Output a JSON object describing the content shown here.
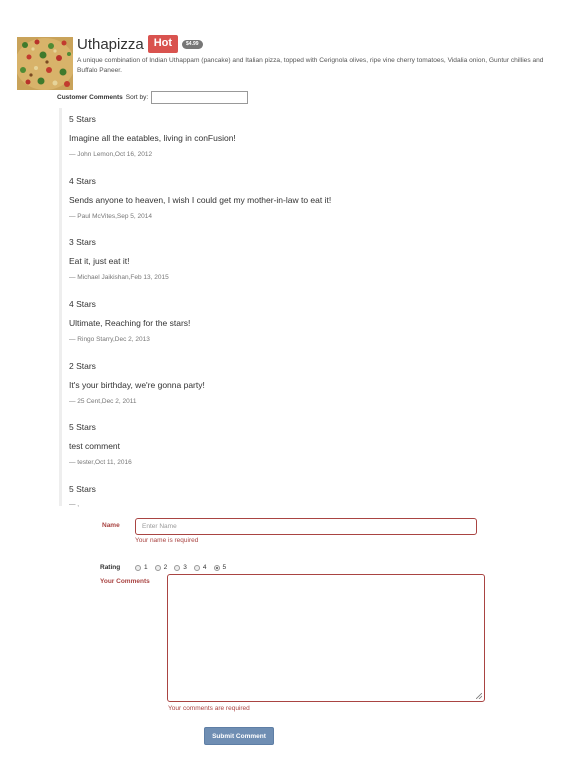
{
  "dish": {
    "name": "Uthapizza",
    "label": "Hot",
    "price": "$4.99",
    "description": "A unique combination of Indian Uthappam (pancake) and Italian pizza, topped with Cerignola olives, ripe vine cherry tomatoes, Vidalia onion, Guntur chillies and Buffalo Paneer."
  },
  "comments_section": {
    "title": "Customer Comments",
    "sort_label": "Sort by:",
    "sort_value": ""
  },
  "comments": [
    {
      "rating": "5 Stars",
      "text": "Imagine all the eatables, living in conFusion!",
      "byline": "— John Lemon,Oct 16, 2012"
    },
    {
      "rating": "4 Stars",
      "text": "Sends anyone to heaven, I wish I could get my mother-in-law to eat it!",
      "byline": "— Paul McVites,Sep 5, 2014"
    },
    {
      "rating": "3 Stars",
      "text": "Eat it, just eat it!",
      "byline": "— Michael Jaikishan,Feb 13, 2015"
    },
    {
      "rating": "4 Stars",
      "text": "Ultimate, Reaching for the stars!",
      "byline": "— Ringo Starry,Dec 2, 2013"
    },
    {
      "rating": "2 Stars",
      "text": "It's your birthday, we're gonna party!",
      "byline": "— 25 Cent,Dec 2, 2011"
    },
    {
      "rating": "5 Stars",
      "text": "test comment",
      "byline": "— tester,Oct 11, 2016"
    }
  ],
  "preview": {
    "rating": "5 Stars",
    "byline": "— ,"
  },
  "form": {
    "name_label": "Name",
    "name_placeholder": "Enter Name",
    "name_error": "Your name is required",
    "rating_label": "Rating",
    "rating_options": [
      "1",
      "2",
      "3",
      "4",
      "5"
    ],
    "rating_selected": "5",
    "comments_label": "Your Comments",
    "comments_error": "Your comments are required",
    "submit_label": "Submit Comment"
  },
  "colors": {
    "error": "#a94442",
    "hot_label": "#d9534f",
    "price_badge": "#777777",
    "submit_button": "#6f8eb3"
  }
}
